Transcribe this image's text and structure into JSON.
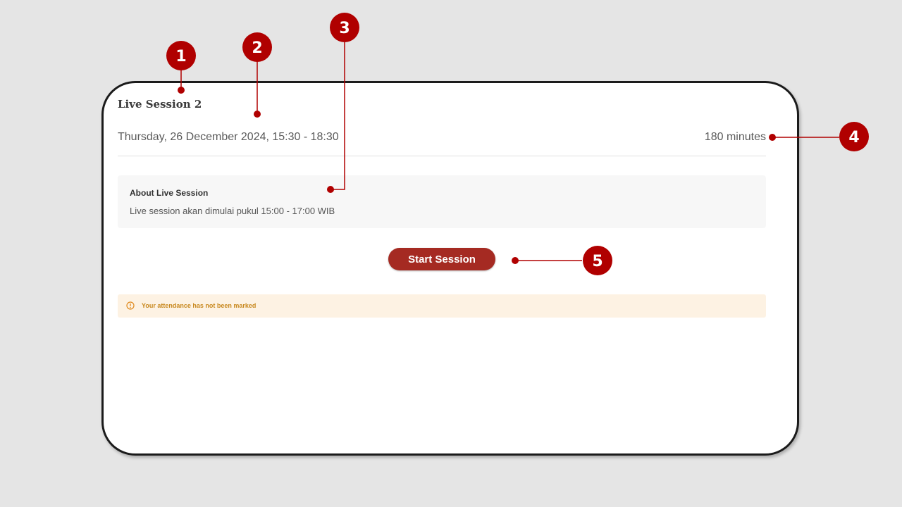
{
  "session": {
    "title": "Live Session 2",
    "datetime": "Thursday, 26 December 2024, 15:30 - 18:30",
    "duration": "180 minutes"
  },
  "about": {
    "heading": "About Live Session",
    "description": "Live session akan dimulai pukul 15:00 - 17:00 WIB"
  },
  "actions": {
    "start_label": "Start Session"
  },
  "attendance": {
    "message": "Your attendance has not been marked",
    "icon": "info-icon"
  },
  "callouts": [
    "1",
    "2",
    "3",
    "4",
    "5"
  ],
  "colors": {
    "accent": "#a52a22",
    "callout": "#b00000",
    "warning_bg": "#fdf2e3",
    "warning_text": "#c8881e"
  }
}
